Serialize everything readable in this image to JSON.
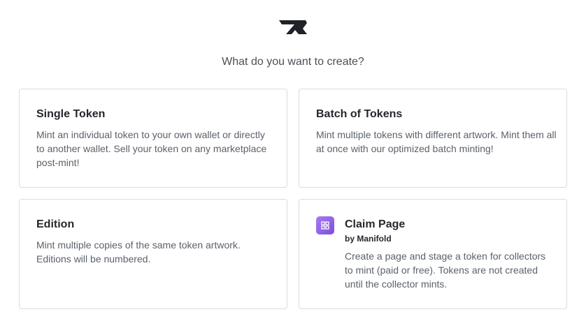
{
  "header": {
    "logo_icon": "manifold-logo-icon",
    "question": "What do you want to create?"
  },
  "options": [
    {
      "title": "Single Token",
      "description": "Mint an individual token to your own wallet or directly to another wallet. Sell your token on any marketplace post-mint!"
    },
    {
      "title": "Batch of Tokens",
      "description": "Mint multiple tokens with different artwork. Mint them all at once with our optimized batch minting!"
    },
    {
      "title": "Edition",
      "description": "Mint multiple copies of the same token artwork. Editions will be numbered."
    },
    {
      "title": "Claim Page",
      "byline": "by Manifold",
      "icon": "claim-page-icon",
      "description": "Create a page and stage a token for collectors to mint (paid or free). Tokens are not created until the collector mints."
    }
  ]
}
